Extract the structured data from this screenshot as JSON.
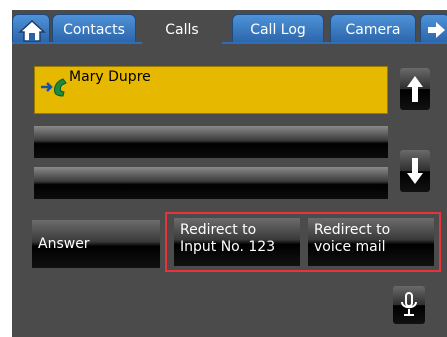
{
  "tabs": {
    "items": [
      {
        "label": "Contacts"
      },
      {
        "label": "Calls"
      },
      {
        "label": "Call Log"
      },
      {
        "label": "Camera"
      }
    ],
    "active": "Calls"
  },
  "calls": {
    "rows": [
      {
        "name": "Mary Dupre",
        "selected": true
      },
      {
        "name": ""
      },
      {
        "name": ""
      }
    ]
  },
  "actions": {
    "answer_label": "Answer",
    "redirect_input_line1": "Redirect to",
    "redirect_input_line2": "Input No. 123",
    "redirect_voicemail_line1": "Redirect to",
    "redirect_voicemail_line2": "voice mail"
  },
  "icons": {
    "home": "home-icon",
    "next": "arrow-right-icon",
    "up": "arrow-up-icon",
    "down": "arrow-down-icon",
    "incoming_call": "incoming-call-icon",
    "microphone": "microphone-icon"
  },
  "colors": {
    "tab_blue": "#3a7cc8",
    "selected_row": "#e7b800",
    "highlight": "#e8333a",
    "background": "#4b4b4b"
  }
}
